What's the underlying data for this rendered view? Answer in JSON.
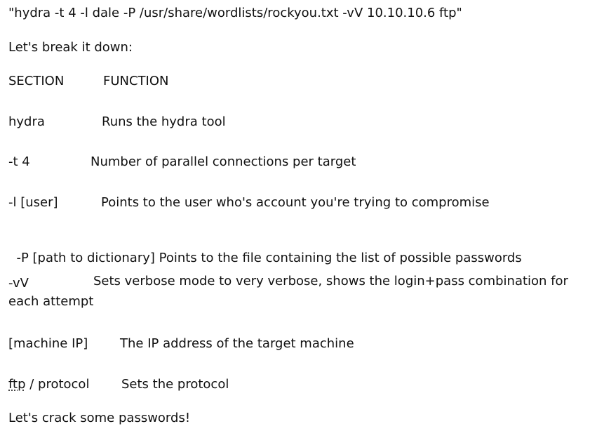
{
  "command": "\"hydra -t 4 -l dale -P /usr/share/wordlists/rockyou.txt -vV 10.10.10.6 ftp\"",
  "intro": "Let's break it down:",
  "header": {
    "section": "SECTION",
    "function": "FUNCTION"
  },
  "rows": [
    {
      "section": "hydra",
      "function": "Runs the hydra tool"
    },
    {
      "section": "-t 4",
      "function": "Number of parallel connections per target"
    },
    {
      "section": "-l [user]",
      "function": "Points to the user who's account you're trying to compromise"
    },
    {
      "section": "-P [path to dictionary]",
      "function": "Points to the file containing the list of possible passwords"
    },
    {
      "section": "-vV",
      "function": "Sets verbose mode to very verbose, shows the login+pass combination for each attempt"
    },
    {
      "section": "[machine IP]",
      "function": "The IP address of the target machine"
    },
    {
      "section_abbr": "ftp",
      "section_rest": " / protocol",
      "function": "Sets the protocol"
    }
  ],
  "outro": "Let's crack some passwords!"
}
